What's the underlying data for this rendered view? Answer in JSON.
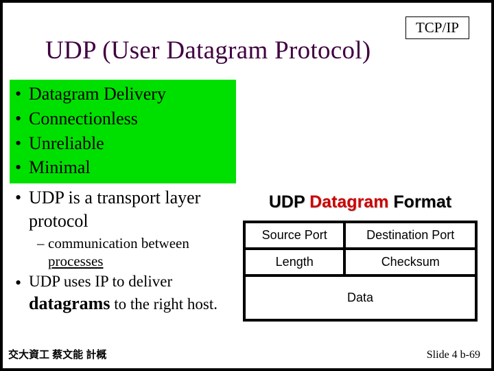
{
  "header": {
    "tcpip_label": "TCP/IP",
    "title": "UDP  (User Datagram Protocol)"
  },
  "bullets": {
    "green": [
      "Datagram Delivery",
      "Connectionless",
      "Unreliable",
      "Minimal"
    ],
    "transport_line": "UDP is a transport layer protocol",
    "sub_comm_prefix": "communication between ",
    "sub_comm_underlined": "processes",
    "ip_deliver_prefix": "UDP uses IP to deliver ",
    "ip_deliver_bold": "datagrams",
    "ip_deliver_suffix": " to the right host."
  },
  "format": {
    "title_udp": "UDP ",
    "title_datagram": "Datagram",
    "title_format": " Format",
    "cells": {
      "src": "Source Port",
      "dst": "Destination Port",
      "len": "Length",
      "chk": "Checksum",
      "data": "Data"
    }
  },
  "footer": {
    "left": "交大資工 蔡文能 計概",
    "right": "Slide 4 b-69"
  }
}
